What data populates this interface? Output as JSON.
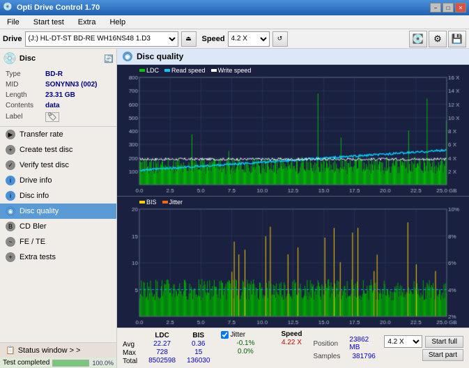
{
  "app": {
    "title": "Opti Drive Control 1.70",
    "icon": "💿"
  },
  "titlebar": {
    "minimize": "−",
    "maximize": "□",
    "close": "✕"
  },
  "menubar": {
    "items": [
      "File",
      "Start test",
      "Extra",
      "Help"
    ]
  },
  "drivebar": {
    "drive_label": "Drive",
    "drive_value": "(J:)  HL-DT-ST BD-RE  WH16NS48 1.D3",
    "speed_label": "Speed",
    "speed_value": "4.2 X"
  },
  "disc": {
    "title": "Disc",
    "type_label": "Type",
    "type_value": "BD-R",
    "mid_label": "MID",
    "mid_value": "SONYNN3 (002)",
    "length_label": "Length",
    "length_value": "23.31 GB",
    "contents_label": "Contents",
    "contents_value": "data",
    "label_label": "Label",
    "label_value": ""
  },
  "nav": {
    "items": [
      {
        "id": "transfer-rate",
        "label": "Transfer rate",
        "active": false
      },
      {
        "id": "create-test-disc",
        "label": "Create test disc",
        "active": false
      },
      {
        "id": "verify-test-disc",
        "label": "Verify test disc",
        "active": false
      },
      {
        "id": "drive-info",
        "label": "Drive info",
        "active": false
      },
      {
        "id": "disc-info",
        "label": "Disc info",
        "active": false
      },
      {
        "id": "disc-quality",
        "label": "Disc quality",
        "active": true
      },
      {
        "id": "cd-bler",
        "label": "CD Bler",
        "active": false
      },
      {
        "id": "fe-te",
        "label": "FE / TE",
        "active": false
      },
      {
        "id": "extra-tests",
        "label": "Extra tests",
        "active": false
      }
    ]
  },
  "status_window": {
    "label": "Status window > >"
  },
  "test_completed": {
    "label": "Test completed",
    "progress": 100
  },
  "disc_quality": {
    "title": "Disc quality",
    "legend": [
      {
        "label": "LDC",
        "color": "#00aa00"
      },
      {
        "label": "Read speed",
        "color": "#00ccff"
      },
      {
        "label": "Write speed",
        "color": "#ffffff"
      }
    ],
    "legend2": [
      {
        "label": "BIS",
        "color": "#ffcc00"
      },
      {
        "label": "Jitter",
        "color": "#ff6600"
      }
    ]
  },
  "stats": {
    "ldc_label": "LDC",
    "bis_label": "BIS",
    "jitter_label": "Jitter",
    "speed_label": "Speed",
    "jitter_checked": true,
    "avg_label": "Avg",
    "max_label": "Max",
    "total_label": "Total",
    "avg_ldc": "22.27",
    "avg_bis": "0.36",
    "avg_jitter": "-0.1%",
    "max_ldc": "728",
    "max_bis": "15",
    "max_jitter": "0.0%",
    "total_ldc": "8502598",
    "total_bis": "136030",
    "speed_value": "4.22 X",
    "position_label": "Position",
    "position_value": "23862 MB",
    "samples_label": "Samples",
    "samples_value": "381796",
    "speed_select": "4.2 X",
    "start_full": "Start full",
    "start_part": "Start part"
  },
  "chart1": {
    "y_max": 800,
    "y_labels": [
      "800",
      "700",
      "600",
      "500",
      "400",
      "300",
      "200",
      "100"
    ],
    "y_right_labels": [
      "16 X",
      "14 X",
      "12 X",
      "10 X",
      "8 X",
      "6 X",
      "4 X",
      "2 X"
    ],
    "x_labels": [
      "0.0",
      "2.5",
      "5.0",
      "7.5",
      "10.0",
      "12.5",
      "15.0",
      "17.5",
      "20.0",
      "22.5",
      "25.0 GB"
    ]
  },
  "chart2": {
    "y_max": 20,
    "y_labels": [
      "20",
      "15",
      "10",
      "5"
    ],
    "y_right_labels": [
      "10%",
      "8%",
      "6%",
      "4%",
      "2%"
    ],
    "x_labels": [
      "0.0",
      "2.5",
      "5.0",
      "7.5",
      "10.0",
      "12.5",
      "15.0",
      "17.5",
      "20.0",
      "22.5",
      "25.0 GB"
    ]
  }
}
